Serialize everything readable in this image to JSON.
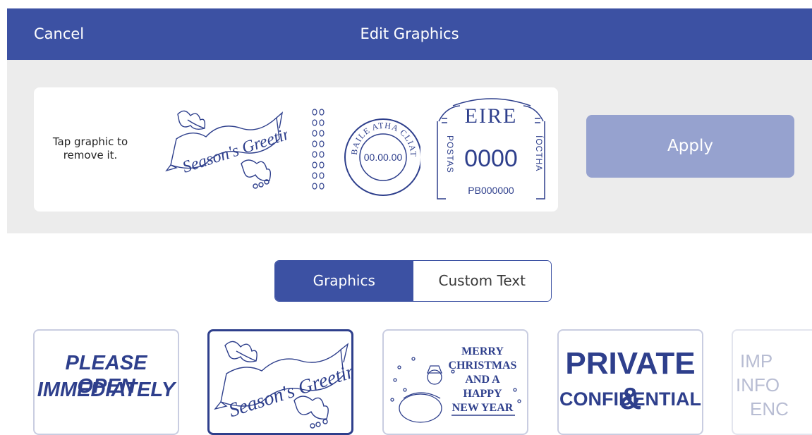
{
  "header": {
    "cancel_label": "Cancel",
    "title": "Edit Graphics"
  },
  "preview": {
    "hint": "Tap graphic to remove it.",
    "graphic_text": "Season's Greetings",
    "dater_ring_text": "BAILE ATHA CLIATH",
    "dater_date": "00.00.00",
    "indicia": {
      "country": "EIRE",
      "value": "0000",
      "serial": "PB000000",
      "left_side": "POSTAS",
      "right_side": "ÍOCTHA"
    }
  },
  "apply_label": "Apply",
  "tabs": [
    {
      "label": "Graphics",
      "active": true
    },
    {
      "label": "Custom Text",
      "active": false
    }
  ],
  "tiles": [
    {
      "line1": "PLEASE OPEN",
      "line2": "IMMEDIATELY"
    },
    {
      "text": "Season's Greetings",
      "selected": true
    },
    {
      "line1": "MERRY",
      "line2": "CHRISTMAS",
      "line3": "AND A",
      "line4": "HAPPY",
      "line5": "NEW YEAR"
    },
    {
      "line1": "PRIVATE &",
      "line2": "CONFIDENTIAL"
    },
    {
      "line1": "IMP",
      "line2": "INFO",
      "line3": "ENC"
    }
  ],
  "colors": {
    "brand": "#3c51a3",
    "apply_disabled": "#96a2cf",
    "ink": "#2e3f8c"
  }
}
